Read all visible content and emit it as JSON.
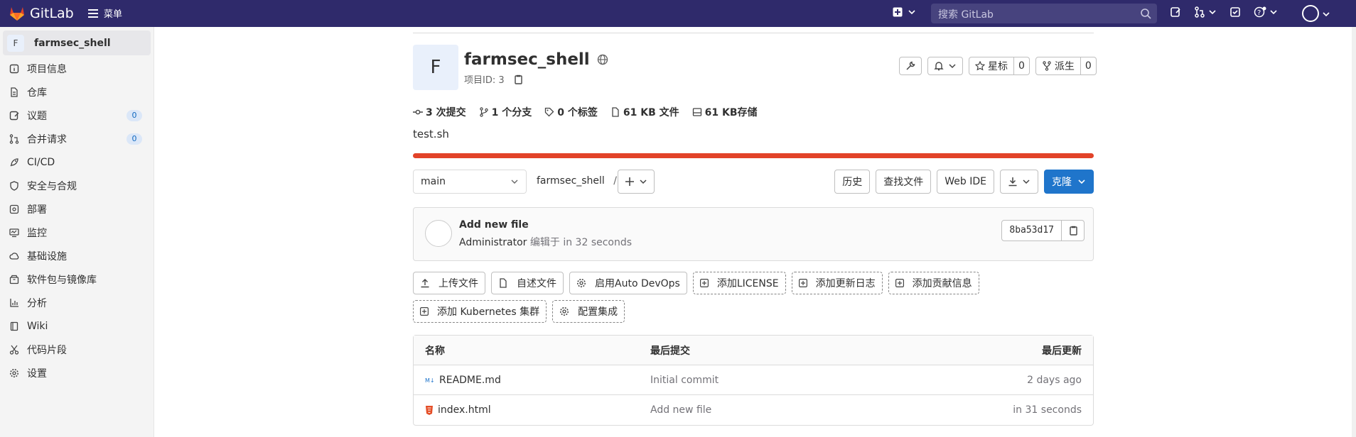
{
  "topbar": {
    "brand": "GitLab",
    "menu_label": "菜单",
    "search_placeholder": "搜索 GitLab"
  },
  "sidebar": {
    "project_initial": "F",
    "project_name": "farmsec_shell",
    "items": [
      {
        "label": "项目信息",
        "icon": "info-icon"
      },
      {
        "label": "仓库",
        "icon": "doc-icon"
      },
      {
        "label": "议题",
        "icon": "issues-icon",
        "badge": "0"
      },
      {
        "label": "合并请求",
        "icon": "merge-icon",
        "badge": "0"
      },
      {
        "label": "CI/CD",
        "icon": "rocket-icon"
      },
      {
        "label": "安全与合规",
        "icon": "shield-icon"
      },
      {
        "label": "部署",
        "icon": "deploy-icon"
      },
      {
        "label": "监控",
        "icon": "monitor-icon"
      },
      {
        "label": "基础设施",
        "icon": "cloud-icon"
      },
      {
        "label": "软件包与镜像库",
        "icon": "package-icon"
      },
      {
        "label": "分析",
        "icon": "chart-icon"
      },
      {
        "label": "Wiki",
        "icon": "book-icon"
      },
      {
        "label": "代码片段",
        "icon": "snippet-icon"
      },
      {
        "label": "设置",
        "icon": "gear-icon"
      }
    ]
  },
  "project": {
    "initial": "F",
    "title": "farmsec_shell",
    "id_label": "项目ID: 3",
    "star_label": "星标",
    "star_count": "0",
    "fork_label": "派生",
    "fork_count": "0",
    "description": "test.sh",
    "progress": 1.0,
    "progress_color": "#e24329"
  },
  "stats": {
    "commits": "3 次提交",
    "branches": "1 个分支",
    "tags": "0 个标签",
    "files": "61 KB 文件",
    "storage": "61 KB存储"
  },
  "toolbar": {
    "branch": "main",
    "path": "farmsec_shell",
    "path_sep": "/",
    "history": "历史",
    "find_file": "查找文件",
    "web_ide": "Web IDE",
    "clone": "克隆"
  },
  "commit": {
    "title": "Add new file",
    "author": "Administrator",
    "edited": "编辑于 in 32 seconds",
    "sha": "8ba53d17"
  },
  "quick_actions": [
    {
      "label": "上传文件",
      "dashed": false
    },
    {
      "label": "自述文件",
      "dashed": false
    },
    {
      "label": "启用Auto DevOps",
      "dashed": false
    },
    {
      "label": "添加LICENSE",
      "dashed": true
    },
    {
      "label": "添加更新日志",
      "dashed": true
    },
    {
      "label": "添加贡献信息",
      "dashed": true
    },
    {
      "label": "添加 Kubernetes 集群",
      "dashed": true
    },
    {
      "label": "配置集成",
      "dashed": true
    }
  ],
  "files": {
    "headers": [
      "名称",
      "最后提交",
      "最后更新"
    ],
    "rows": [
      {
        "name": "README.md",
        "icon": "markdown-icon",
        "commit": "Initial commit",
        "updated": "2 days ago"
      },
      {
        "name": "index.html",
        "icon": "html-icon",
        "commit": "Add new file",
        "updated": "in 31 seconds"
      }
    ]
  },
  "colors": {
    "navbar": "#2f2a6b",
    "primary": "#1f75cb",
    "badge": "#dbe7f8"
  }
}
